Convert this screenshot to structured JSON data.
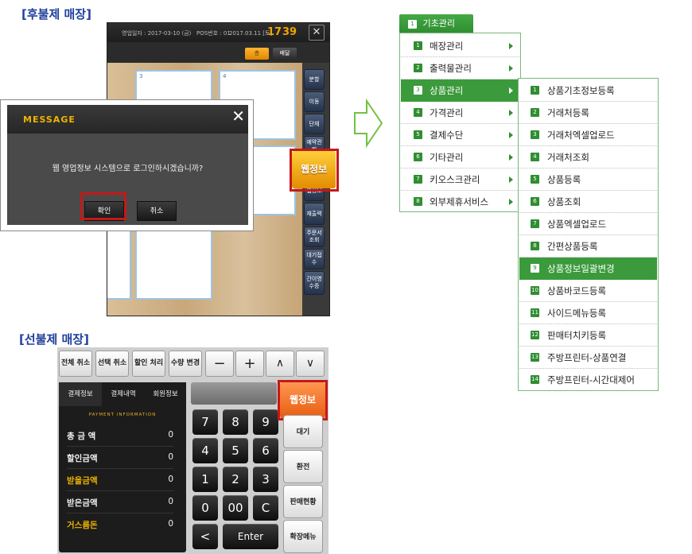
{
  "headings": {
    "postpaid": "[후불제 매장]",
    "prepaid": "[선불제 매장]"
  },
  "pos1": {
    "header_biz_date": "영업일자 : 2017-03-10 (금)",
    "header_pos_no": "POS번호 : 01",
    "header_date": "2017.03.11 [토]",
    "clock_hour": "17",
    "clock_min": "39",
    "close_label": "✕",
    "btn_floor": "층",
    "btn_parcel": "배달",
    "table_numbers": [
      "3",
      "4"
    ],
    "side_buttons": [
      "분할",
      "이동",
      "단체",
      "예약관리",
      "웹정보",
      "재출력",
      "주문서 조회",
      "대기접수",
      "간이영수증"
    ],
    "web_button": "웹정보"
  },
  "dialog": {
    "title": "MESSAGE",
    "close": "✕",
    "text": "웹 영업정보 시스템으로 로그인하시겠습니까?",
    "ok": "확인",
    "cancel": "취소"
  },
  "menu": {
    "tab_num": "1",
    "tab_label": "기초관리",
    "items": [
      {
        "num": "1",
        "label": "매장관리"
      },
      {
        "num": "2",
        "label": "출력물관리"
      },
      {
        "num": "3",
        "label": "상품관리"
      },
      {
        "num": "4",
        "label": "가격관리"
      },
      {
        "num": "5",
        "label": "결제수단"
      },
      {
        "num": "6",
        "label": "기타관리"
      },
      {
        "num": "7",
        "label": "키오스크관리"
      },
      {
        "num": "8",
        "label": "외부제휴서비스"
      }
    ],
    "sub_items": [
      {
        "num": "1",
        "label": "상품기초정보등록"
      },
      {
        "num": "2",
        "label": "거래처등록"
      },
      {
        "num": "3",
        "label": "거래처엑셀업로드"
      },
      {
        "num": "4",
        "label": "거래처조회"
      },
      {
        "num": "5",
        "label": "상품등록"
      },
      {
        "num": "6",
        "label": "상품조회"
      },
      {
        "num": "7",
        "label": "상품엑셀업로드"
      },
      {
        "num": "8",
        "label": "간편상품등록"
      },
      {
        "num": "9",
        "label": "상품정보일괄변경"
      },
      {
        "num": "10",
        "label": "상품바코드등록"
      },
      {
        "num": "11",
        "label": "사이드메뉴등록"
      },
      {
        "num": "12",
        "label": "판매터치키등록"
      },
      {
        "num": "13",
        "label": "주방프린터-상품연결"
      },
      {
        "num": "14",
        "label": "주방프린터-시간대제어"
      }
    ]
  },
  "pos2": {
    "top_buttons": [
      "전체 취소",
      "선택 취소",
      "할인 처리",
      "수량 변경"
    ],
    "top_icons": [
      "−",
      "+",
      "∧",
      "∨"
    ],
    "tabs": [
      "결제정보",
      "결제내역",
      "회원정보"
    ],
    "payment_info": "PAYMENT INFORMATION",
    "rows": [
      {
        "label": "총 금 액",
        "value": "0"
      },
      {
        "label": "할인금액",
        "value": "0"
      },
      {
        "label": "받을금액",
        "value": "0"
      },
      {
        "label": "받은금액",
        "value": "0"
      },
      {
        "label": "거스름돈",
        "value": "0"
      }
    ],
    "keys": [
      "7",
      "8",
      "9",
      "4",
      "5",
      "6",
      "1",
      "2",
      "3",
      "0",
      "00",
      "C",
      "<",
      "Enter"
    ],
    "web_button": "웹정보",
    "right_buttons": [
      "대기",
      "환전",
      "판매현황",
      "확장메뉴"
    ]
  }
}
